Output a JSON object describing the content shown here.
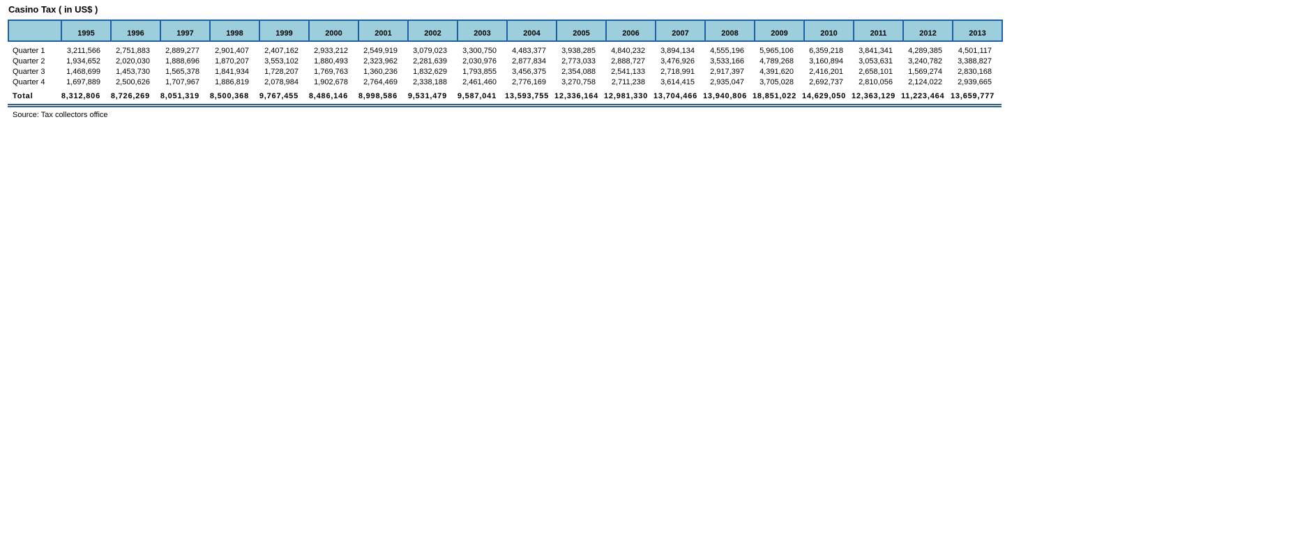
{
  "page": {
    "title": "Casino Tax ( in US$ )",
    "source_note": "Source: Tax collectors office"
  },
  "colors": {
    "header_fill": "#9CCEDC",
    "header_border": "#1B61AA",
    "total_rule": "#35618E",
    "text": "#000000",
    "background": "#FFFFFF"
  },
  "chart_data": {
    "type": "table",
    "title": "Casino Tax ( in US$ )",
    "years": [
      "1995",
      "1996",
      "1997",
      "1998",
      "1999",
      "2000",
      "2001",
      "2002",
      "2003",
      "2004",
      "2005",
      "2006",
      "2007",
      "2008",
      "2009",
      "2010",
      "2011",
      "2012",
      "2013"
    ],
    "rows": [
      {
        "label": "Quarter 1",
        "values": [
          "3,211,566",
          "2,751,883",
          "2,889,277",
          "2,901,407",
          "2,407,162",
          "2,933,212",
          "2,549,919",
          "3,079,023",
          "3,300,750",
          "4,483,377",
          "3,938,285",
          "4,840,232",
          "3,894,134",
          "4,555,196",
          "5,965,106",
          "6,359,218",
          "3,841,341",
          "4,289,385",
          "4,501,117"
        ]
      },
      {
        "label": "Quarter 2",
        "values": [
          "1,934,652",
          "2,020,030",
          "1,888,696",
          "1,870,207",
          "3,553,102",
          "1,880,493",
          "2,323,962",
          "2,281,639",
          "2,030,976",
          "2,877,834",
          "2,773,033",
          "2,888,727",
          "3,476,926",
          "3,533,166",
          "4,789,268",
          "3,160,894",
          "3,053,631",
          "3,240,782",
          "3,388,827"
        ]
      },
      {
        "label": "Quarter 3",
        "values": [
          "1,468,699",
          "1,453,730",
          "1,565,378",
          "1,841,934",
          "1,728,207",
          "1,769,763",
          "1,360,236",
          "1,832,629",
          "1,793,855",
          "3,456,375",
          "2,354,088",
          "2,541,133",
          "2,718,991",
          "2,917,397",
          "4,391,620",
          "2,416,201",
          "2,658,101",
          "1,569,274",
          "2,830,168"
        ]
      },
      {
        "label": "Quarter 4",
        "values": [
          "1,697,889",
          "2,500,626",
          "1,707,967",
          "1,886,819",
          "2,078,984",
          "1,902,678",
          "2,764,469",
          "2,338,188",
          "2,461,460",
          "2,776,169",
          "3,270,758",
          "2,711,238",
          "3,614,415",
          "2,935,047",
          "3,705,028",
          "2,692,737",
          "2,810,056",
          "2,124,022",
          "2,939,665"
        ]
      }
    ],
    "total_row": {
      "label": "Total",
      "values": [
        "8,312,806",
        "8,726,269",
        "8,051,319",
        "8,500,368",
        "9,767,455",
        "8,486,146",
        "8,998,586",
        "9,531,479",
        "9,587,041",
        "13,593,755",
        "12,336,164",
        "12,981,330",
        "13,704,466",
        "13,940,806",
        "18,851,022",
        "14,629,050",
        "12,363,129",
        "11,223,464",
        "13,659,777"
      ]
    }
  }
}
